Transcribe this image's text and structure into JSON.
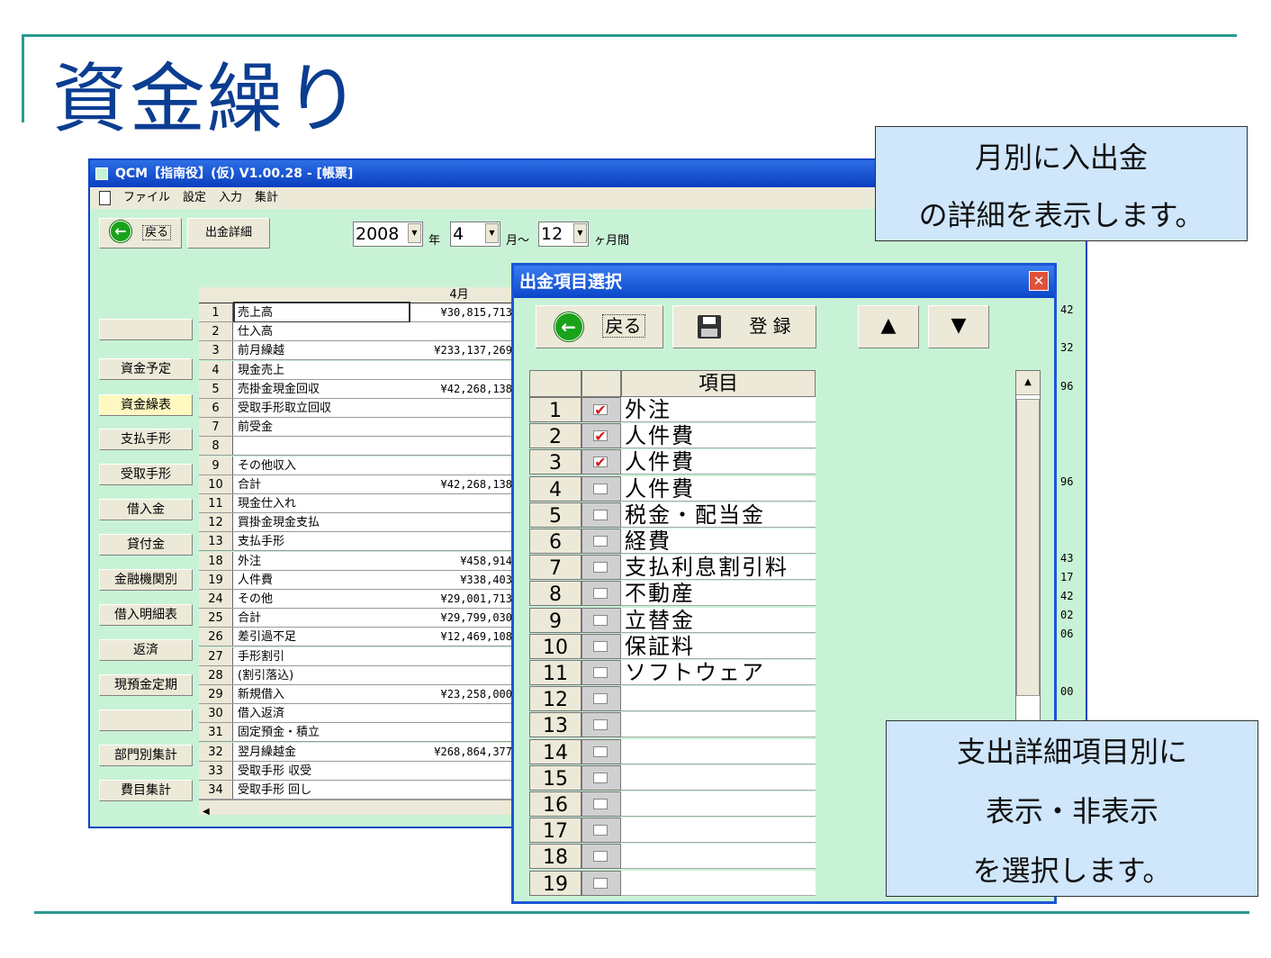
{
  "slide": {
    "title": "資金繰り"
  },
  "window": {
    "title": "QCM【指南役】(仮) V1.00.28 - [帳票]",
    "menu": [
      "ファイル",
      "設定",
      "入力",
      "集計"
    ],
    "toolbar": {
      "back_label": "戻る",
      "detail_label": "出金詳細",
      "year": "2008",
      "year_suffix": "年",
      "month": "4",
      "month_suffix": "月～",
      "months_count": "12",
      "months_suffix": "ヶ月間"
    },
    "sidebar": [
      "",
      "資金予定",
      "資金繰表",
      "支払手形",
      "受取手形",
      "借入金",
      "貸付金",
      "金融機関別",
      "借入明細表",
      "返済",
      "現預金定期",
      "",
      "部門別集計",
      "費目集計"
    ],
    "grid": {
      "column_header": "4月",
      "rows": [
        {
          "no": "1",
          "name": "売上高",
          "value": "¥30,815,713"
        },
        {
          "no": "2",
          "name": "仕入高",
          "value": ""
        },
        {
          "no": "3",
          "name": "前月繰越",
          "value": "¥233,137,269"
        },
        {
          "no": "4",
          "name": "現金売上",
          "value": ""
        },
        {
          "no": "5",
          "name": "売掛金現金回収",
          "value": "¥42,268,138"
        },
        {
          "no": "6",
          "name": "受取手形取立回収",
          "value": ""
        },
        {
          "no": "7",
          "name": "前受金",
          "value": ""
        },
        {
          "no": "8",
          "name": "",
          "value": ""
        },
        {
          "no": "9",
          "name": "その他収入",
          "value": ""
        },
        {
          "no": "10",
          "name": "合計",
          "value": "¥42,268,138"
        },
        {
          "no": "11",
          "name": "現金仕入れ",
          "value": ""
        },
        {
          "no": "12",
          "name": "買掛金現金支払",
          "value": ""
        },
        {
          "no": "13",
          "name": "支払手形",
          "value": ""
        },
        {
          "no": "18",
          "name": "外注",
          "value": "¥458,914"
        },
        {
          "no": "19",
          "name": "人件費",
          "value": "¥338,403"
        },
        {
          "no": "24",
          "name": "その他",
          "value": "¥29,001,713"
        },
        {
          "no": "25",
          "name": "合計",
          "value": "¥29,799,030"
        },
        {
          "no": "26",
          "name": "差引過不足",
          "value": "¥12,469,108"
        },
        {
          "no": "27",
          "name": "手形割引",
          "value": ""
        },
        {
          "no": "28",
          "name": "(割引落込)",
          "value": ""
        },
        {
          "no": "29",
          "name": "新規借入",
          "value": "¥23,258,000"
        },
        {
          "no": "30",
          "name": "借入返済",
          "value": ""
        },
        {
          "no": "31",
          "name": "固定預金・積立",
          "value": ""
        },
        {
          "no": "32",
          "name": "翌月繰越金",
          "value": "¥268,864,377"
        },
        {
          "no": "33",
          "name": "受取手形 収受",
          "value": ""
        },
        {
          "no": "34",
          "name": "受取手形 回し",
          "value": ""
        }
      ],
      "right_edge_values": [
        "42",
        "",
        "32",
        "",
        "96",
        "",
        "",
        "",
        "",
        "96",
        "",
        "",
        "",
        "43",
        "17",
        "42",
        "02",
        "06",
        "",
        "",
        "00"
      ]
    }
  },
  "dialog": {
    "title": "出金項目選択",
    "close": "✕",
    "back_label": "戻る",
    "save_label": "登 録",
    "up_label": "▲",
    "down_label": "▼",
    "column_header": "項目",
    "rows": [
      {
        "no": "1",
        "checked": true,
        "name": "外注"
      },
      {
        "no": "2",
        "checked": true,
        "name": "人件費"
      },
      {
        "no": "3",
        "checked": true,
        "name": "人件費"
      },
      {
        "no": "4",
        "checked": false,
        "name": "人件費"
      },
      {
        "no": "5",
        "checked": false,
        "name": "税金・配当金"
      },
      {
        "no": "6",
        "checked": false,
        "name": "経費"
      },
      {
        "no": "7",
        "checked": false,
        "name": "支払利息割引料"
      },
      {
        "no": "8",
        "checked": false,
        "name": "不動産"
      },
      {
        "no": "9",
        "checked": false,
        "name": "立替金"
      },
      {
        "no": "10",
        "checked": false,
        "name": "保証料"
      },
      {
        "no": "11",
        "checked": false,
        "name": "ソフトウェア"
      },
      {
        "no": "12",
        "checked": false,
        "name": ""
      },
      {
        "no": "13",
        "checked": false,
        "name": ""
      },
      {
        "no": "14",
        "checked": false,
        "name": ""
      },
      {
        "no": "15",
        "checked": false,
        "name": ""
      },
      {
        "no": "16",
        "checked": false,
        "name": ""
      },
      {
        "no": "17",
        "checked": false,
        "name": ""
      },
      {
        "no": "18",
        "checked": false,
        "name": ""
      },
      {
        "no": "19",
        "checked": false,
        "name": ""
      }
    ]
  },
  "callouts": {
    "top": [
      "月別に入出金",
      "の詳細を表示します。"
    ],
    "bottom": [
      "支出詳細項目別に",
      "表示・非表示",
      "を選択します。"
    ]
  },
  "colors": {
    "accent_rule": "#2a9a8e",
    "title_text": "#0b3d91",
    "window_bg": "#c8f2d6",
    "titlebar": "#0a3fbf",
    "callout_bg": "#cfe6fb",
    "check_mark": "#d41c1c"
  },
  "icons": {
    "back": "left-arrow-circle-icon",
    "save": "floppy-disk-icon",
    "close": "close-icon"
  }
}
